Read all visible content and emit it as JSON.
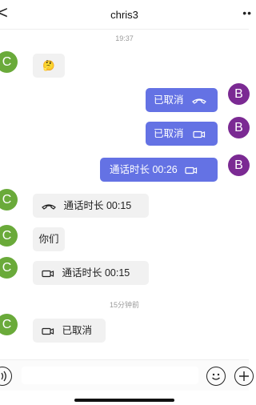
{
  "header": {
    "title": "chris3",
    "back_glyph": "<",
    "more_glyph": "••"
  },
  "timestamps": {
    "first": "19:37",
    "second": "15分钟前"
  },
  "avatars": {
    "contact_initial": "C",
    "self_initial": "B"
  },
  "messages": [
    {
      "side": "in",
      "kind": "emoji",
      "text": "🤔"
    },
    {
      "side": "out",
      "kind": "call-canceled-voice",
      "text": "已取消",
      "icon": "phone-hangup-icon"
    },
    {
      "side": "out",
      "kind": "call-canceled-video",
      "text": "已取消",
      "icon": "video-icon"
    },
    {
      "side": "out",
      "kind": "call-duration-video",
      "text": "通话时长 00:26",
      "icon": "video-icon"
    },
    {
      "side": "in",
      "kind": "call-duration-voice",
      "text": "通话时长 00:15",
      "icon": "phone-hangup-icon"
    },
    {
      "side": "in",
      "kind": "text",
      "text": "你们"
    },
    {
      "side": "in",
      "kind": "call-duration-video",
      "text": "通话时长 00:15",
      "icon": "video-icon"
    },
    {
      "side": "in",
      "kind": "call-canceled-video",
      "text": "已取消",
      "icon": "video-icon"
    }
  ],
  "input_bar": {
    "voice_icon": "voice-icon",
    "emoji_icon": "emoji-icon",
    "plus_icon": "plus-icon",
    "placeholder": ""
  },
  "colors": {
    "outgoing_bubble": "#6472e4",
    "incoming_bubble": "#f1f1f1",
    "contact_avatar": "#6aaa3a",
    "self_avatar": "#7b2a93"
  }
}
